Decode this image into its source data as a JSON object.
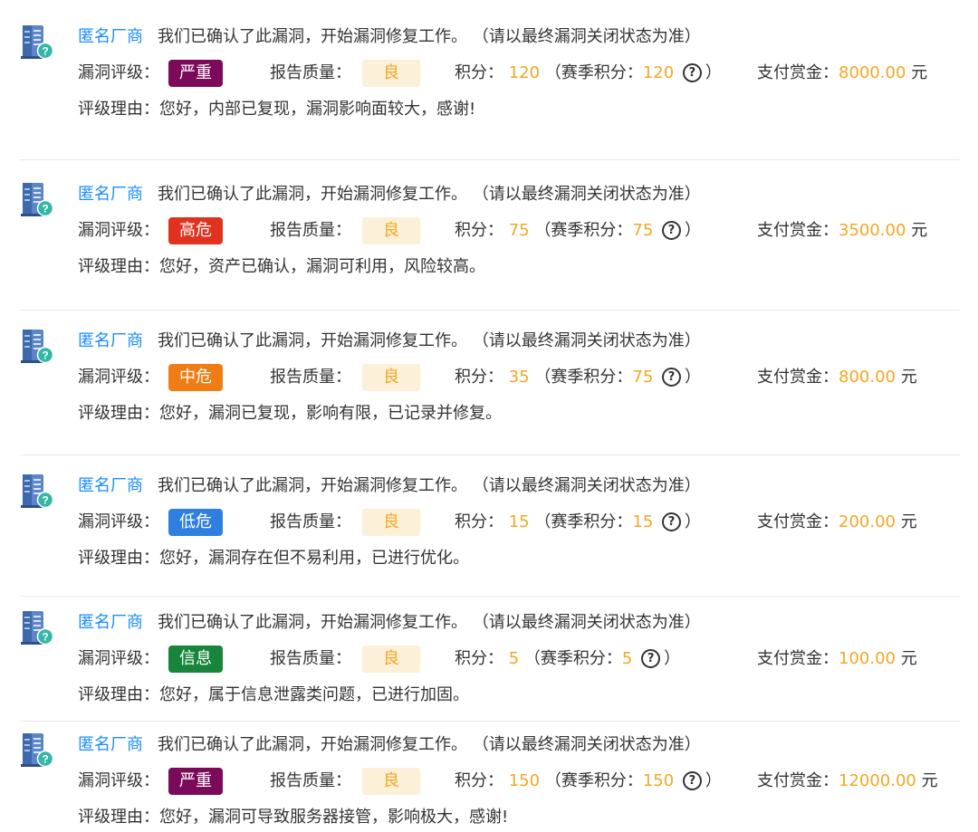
{
  "entries": [
    {
      "vendor": "匿名厂商",
      "message": "我们已确认了此漏洞，开始漏洞修复工作。 （请以最终漏洞关闭状态为准）",
      "rating_label": "漏洞评级：",
      "rating": "严重",
      "rating_color": "#7b0a5a",
      "quality_label": "报告质量：",
      "quality": "良",
      "points_label": "积分：",
      "points": "120",
      "season_open": "（赛季积分：",
      "season_points": "120",
      "help_glyph": "?",
      "season_close": "）",
      "bounty_label": "支付赏金：",
      "bounty": "8000.00",
      "currency": "元",
      "reason_label": "评级理由：",
      "reason": "您好，内部已复现，漏洞影响面较大，感谢!"
    },
    {
      "vendor": "匿名厂商",
      "message": "我们已确认了此漏洞，开始漏洞修复工作。 （请以最终漏洞关闭状态为准）",
      "rating_label": "漏洞评级：",
      "rating": "高危",
      "rating_color": "#e0321e",
      "quality_label": "报告质量：",
      "quality": "良",
      "points_label": "积分：",
      "points": "75",
      "season_open": "（赛季积分：",
      "season_points": "75",
      "help_glyph": "?",
      "season_close": "）",
      "bounty_label": "支付赏金：",
      "bounty": "3500.00",
      "currency": "元",
      "reason_label": "评级理由：",
      "reason": "您好，资产已确认，漏洞可利用，风险较高。"
    },
    {
      "vendor": "匿名厂商",
      "message": "我们已确认了此漏洞，开始漏洞修复工作。 （请以最终漏洞关闭状态为准）",
      "rating_label": "漏洞评级：",
      "rating": "中危",
      "rating_color": "#ef7d14",
      "quality_label": "报告质量：",
      "quality": "良",
      "points_label": "积分：",
      "points": "35",
      "season_open": "（赛季积分：",
      "season_points": "75",
      "help_glyph": "?",
      "season_close": "）",
      "bounty_label": "支付赏金：",
      "bounty": "800.00",
      "currency": "元",
      "reason_label": "评级理由：",
      "reason": "您好，漏洞已复现，影响有限，已记录并修复。"
    },
    {
      "vendor": "匿名厂商",
      "message": "我们已确认了此漏洞，开始漏洞修复工作。 （请以最终漏洞关闭状态为准）",
      "rating_label": "漏洞评级：",
      "rating": "低危",
      "rating_color": "#2f7fe0",
      "quality_label": "报告质量：",
      "quality": "良",
      "points_label": "积分：",
      "points": "15",
      "season_open": "（赛季积分：",
      "season_points": "15",
      "help_glyph": "?",
      "season_close": "）",
      "bounty_label": "支付赏金：",
      "bounty": "200.00",
      "currency": "元",
      "reason_label": "评级理由：",
      "reason": "您好，漏洞存在但不易利用，已进行优化。"
    },
    {
      "vendor": "匿名厂商",
      "message": "我们已确认了此漏洞，开始漏洞修复工作。 （请以最终漏洞关闭状态为准）",
      "rating_label": "漏洞评级：",
      "rating": "信息",
      "rating_color": "#17853a",
      "quality_label": "报告质量：",
      "quality": "良",
      "points_label": "积分：",
      "points": "5",
      "season_open": "（赛季积分：",
      "season_points": "5",
      "help_glyph": "?",
      "season_close": "）",
      "bounty_label": "支付赏金：",
      "bounty": "100.00",
      "currency": "元",
      "reason_label": "评级理由：",
      "reason": "您好，属于信息泄露类问题，已进行加固。"
    },
    {
      "vendor": "匿名厂商",
      "message": "我们已确认了此漏洞，开始漏洞修复工作。 （请以最终漏洞关闭状态为准）",
      "rating_label": "漏洞评级：",
      "rating": "严重",
      "rating_color": "#7b0a5a",
      "quality_label": "报告质量：",
      "quality": "良",
      "points_label": "积分：",
      "points": "150",
      "season_open": "（赛季积分：",
      "season_points": "150",
      "help_glyph": "?",
      "season_close": "）",
      "bounty_label": "支付赏金：",
      "bounty": "12000.00",
      "currency": "元",
      "reason_label": "评级理由：",
      "reason": "您好，漏洞可导致服务器接管，影响极大，感谢!"
    }
  ],
  "colors": {
    "vendor_link": "#1a8cff",
    "highlight": "#f5a623",
    "quality_bg": "#fdf0d8",
    "divider": "#e8e8e8"
  },
  "icons": {
    "vendor_avatar": "building-question-icon",
    "help": "question-circle-icon"
  }
}
